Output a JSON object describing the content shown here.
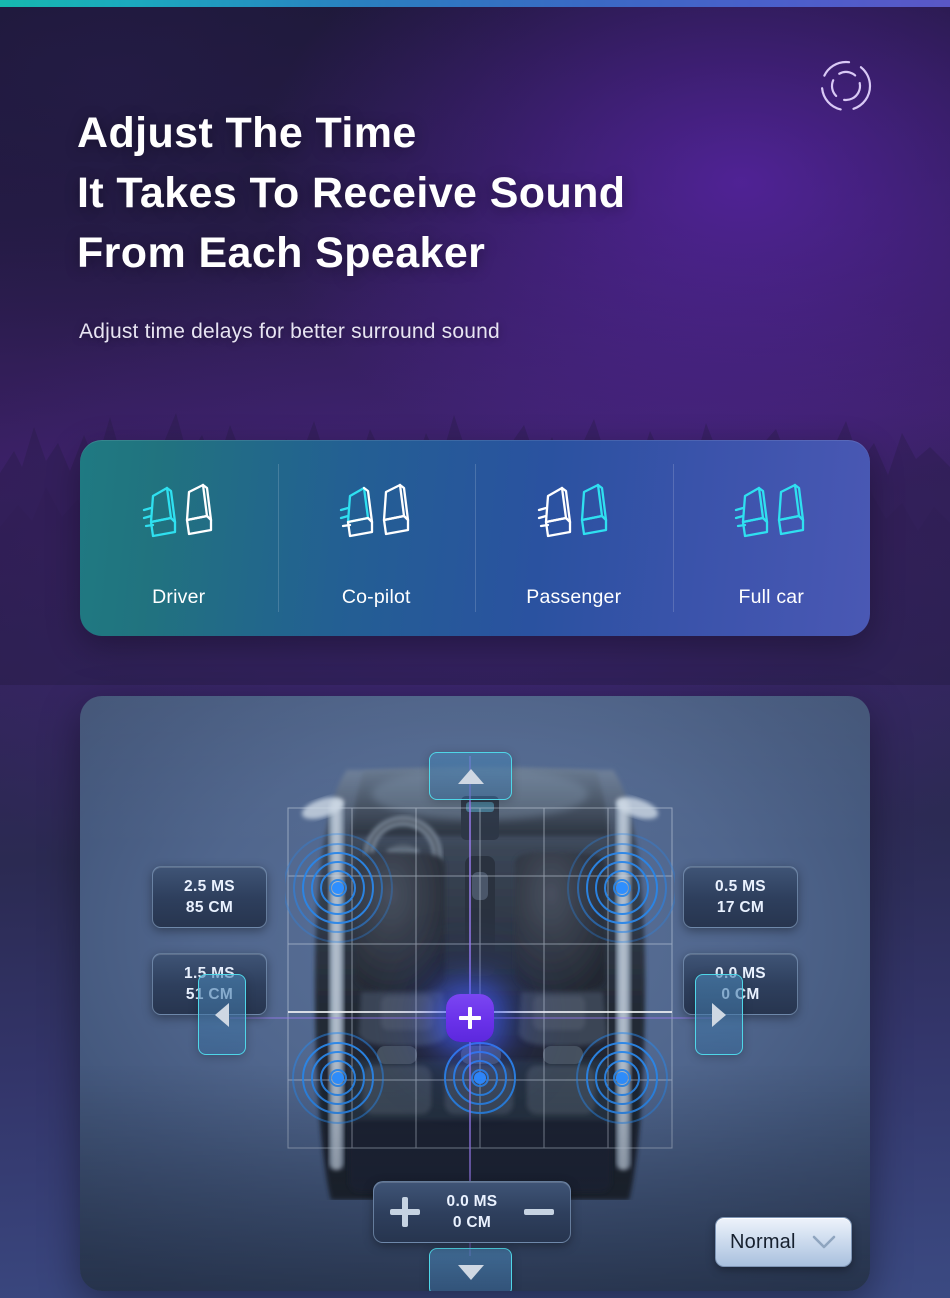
{
  "header": {
    "title_lines": [
      "Adjust The Time",
      "It Takes To Receive Sound",
      "From Each Speaker"
    ],
    "subtitle": "Adjust time delays for better surround sound",
    "decor_icon": "radar-target-icon"
  },
  "tabs": {
    "items": [
      {
        "label": "Driver",
        "icon": "two-seats-driver-icon",
        "selected": true
      },
      {
        "label": "Co-pilot",
        "icon": "two-seats-copilot-icon",
        "selected": false
      },
      {
        "label": "Passenger",
        "icon": "two-seats-passenger-icon",
        "selected": false
      },
      {
        "label": "Full car",
        "icon": "two-seats-fullcar-icon",
        "selected": false
      }
    ]
  },
  "panel": {
    "values": {
      "front_left": {
        "ms": "2.5 MS",
        "cm": "85 CM"
      },
      "rear_left": {
        "ms": "1.5 MS",
        "cm": "51 CM"
      },
      "front_right": {
        "ms": "0.5 MS",
        "cm": "17 CM"
      },
      "rear_right": {
        "ms": "0.0 MS",
        "cm": "0 CM"
      },
      "center": {
        "ms": "0.0 MS",
        "cm": "0 CM"
      }
    },
    "pads": {
      "up": "up-arrow-icon",
      "down": "down-arrow-icon",
      "left": "left-arrow-icon",
      "right": "right-arrow-icon"
    },
    "stepper": {
      "increase_icon": "plus-icon",
      "decrease_icon": "minus-icon"
    },
    "center_marker_icon": "plus-icon",
    "mode_select": {
      "value": "Normal",
      "chevron_icon": "chevron-down-icon"
    }
  },
  "colors": {
    "accent_cyan": "#4fd6e8",
    "accent_purple": "#6a32ea",
    "speaker_ring": "#2b7fe0",
    "panel_blue": "#50668d"
  }
}
